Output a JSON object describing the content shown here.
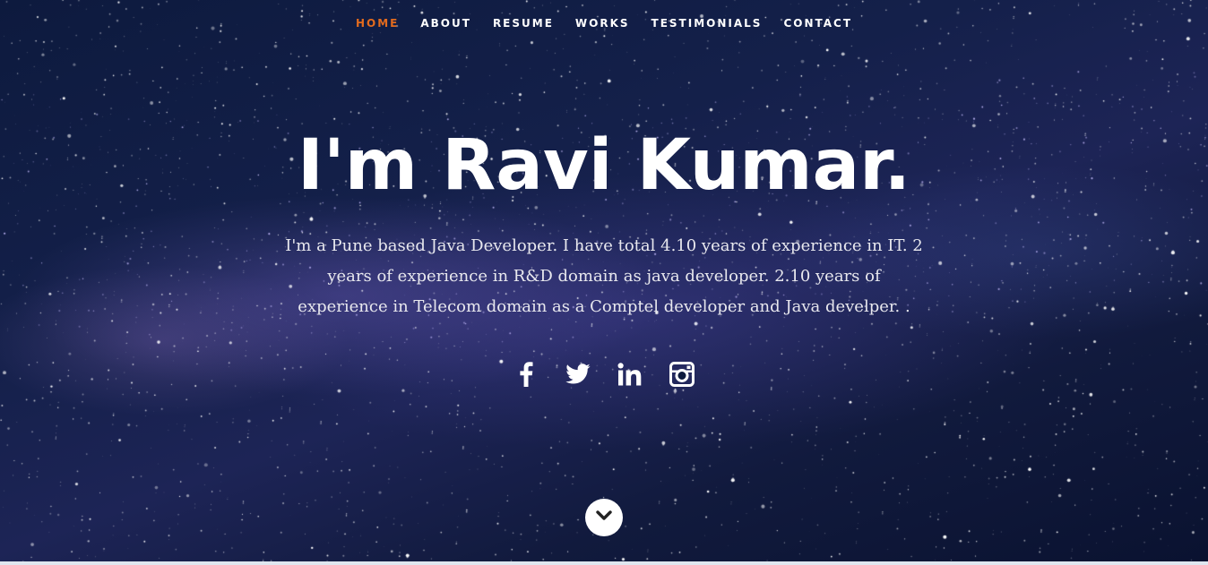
{
  "nav": {
    "items": [
      {
        "label": "HOME",
        "active": true
      },
      {
        "label": "ABOUT",
        "active": false
      },
      {
        "label": "RESUME",
        "active": false
      },
      {
        "label": "WORKS",
        "active": false
      },
      {
        "label": "TESTIMONIALS",
        "active": false
      },
      {
        "label": "CONTACT",
        "active": false
      }
    ],
    "active_color": "#e36b1e"
  },
  "hero": {
    "headline": "I'm Ravi Kumar.",
    "intro": "I'm a Pune based Java Developer. I have total 4.10 years of experience in IT. 2 years of experience in R&D domain as java developer. 2.10 years of experience in Telecom domain as a Comptel developer and Java develper. ."
  },
  "social": [
    {
      "icon": "facebook-icon"
    },
    {
      "icon": "twitter-icon"
    },
    {
      "icon": "linkedin-icon"
    },
    {
      "icon": "instagram-icon"
    }
  ],
  "scroll": {
    "icon": "chevron-down-icon"
  }
}
